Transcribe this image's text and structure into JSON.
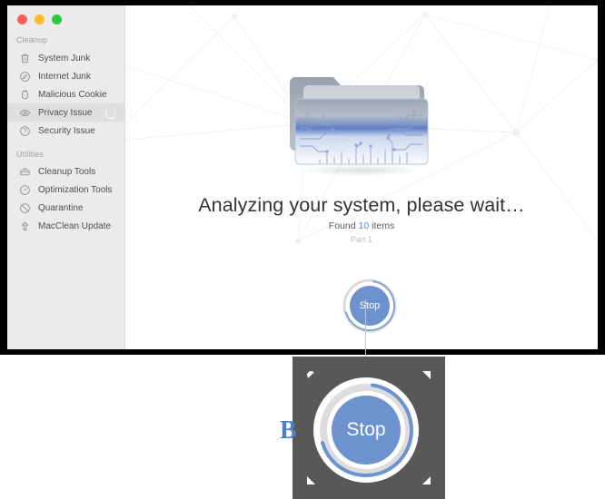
{
  "window": {
    "traffic_lights": [
      {
        "name": "close",
        "color": "#fb5f57"
      },
      {
        "name": "minimize",
        "color": "#fcbc2d"
      },
      {
        "name": "zoom",
        "color": "#2ec840"
      }
    ]
  },
  "sidebar": {
    "groups": [
      {
        "label": "Cleanup",
        "items": [
          {
            "label": "System Junk",
            "icon": "trash-icon",
            "selected": false
          },
          {
            "label": "Internet Junk",
            "icon": "compass-icon",
            "selected": false
          },
          {
            "label": "Malicious Cookie",
            "icon": "cookie-icon",
            "selected": false
          },
          {
            "label": "Privacy Issue",
            "icon": "eye-icon",
            "selected": true
          },
          {
            "label": "Security Issue",
            "icon": "shield-icon",
            "selected": false
          }
        ]
      },
      {
        "label": "Utilities",
        "items": [
          {
            "label": "Cleanup Tools",
            "icon": "toolbox-icon",
            "selected": false
          },
          {
            "label": "Optimization Tools",
            "icon": "speedometer-icon",
            "selected": false
          },
          {
            "label": "Quarantine",
            "icon": "no-entry-icon",
            "selected": false
          },
          {
            "label": "MacClean Update",
            "icon": "upload-arrow-icon",
            "selected": false
          }
        ]
      }
    ]
  },
  "main": {
    "illustration": "folder-circuit-illustration",
    "headline": "Analyzing your system, please wait…",
    "found_prefix": "Found ",
    "found_count": "10",
    "found_suffix": " items",
    "part_label": "Part 1",
    "stop_button_label": "Stop",
    "progress_percent": 68,
    "accent_color": "#6d93ce",
    "count_color": "#5b8bd0"
  },
  "zoom_callout": {
    "stop_button_label": "Stop",
    "panel_color": "#585858",
    "badge_glyph": "B"
  }
}
